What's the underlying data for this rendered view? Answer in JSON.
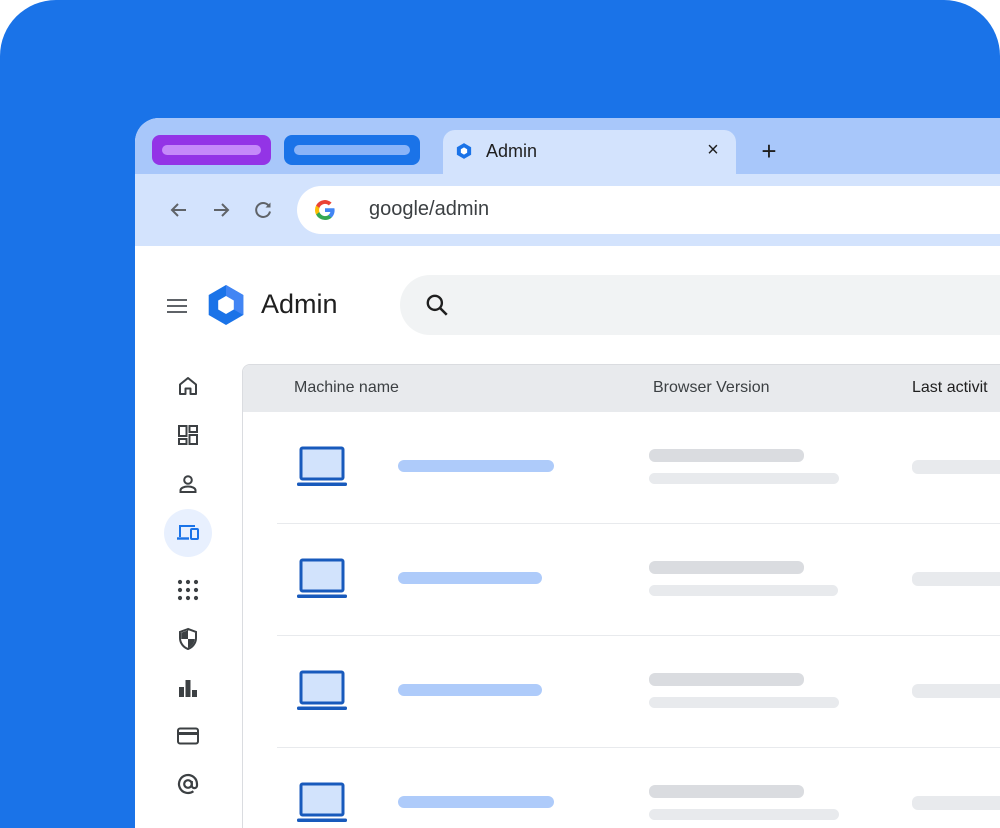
{
  "colors": {
    "backdrop": "#1a73e8",
    "tabstrip": "#a8c7fa",
    "active_tab": "#d3e3fd",
    "accent_blue": "#1a73e8",
    "purple_tab": "#9334e6",
    "skeleton_blue": "#aecbfa",
    "skeleton_gray": "#dadce0"
  },
  "browser": {
    "active_tab": {
      "title": "Admin",
      "favicon": "admin-hexagon-icon",
      "close_glyph": "×"
    },
    "new_tab_glyph": "+",
    "address_bar": {
      "url": "google/admin",
      "icon": "google-g-icon"
    }
  },
  "app": {
    "title": "Admin",
    "menu_icon": "hamburger-menu-icon",
    "search_icon": "search-icon",
    "rail": [
      {
        "name": "home-icon",
        "active": false
      },
      {
        "name": "dashboard-icon",
        "active": false
      },
      {
        "name": "person-icon",
        "active": false
      },
      {
        "name": "devices-icon",
        "active": true
      },
      {
        "name": "apps-grid-icon",
        "active": false
      },
      {
        "name": "security-shield-icon",
        "active": false
      },
      {
        "name": "reports-bar-chart-icon",
        "active": false
      },
      {
        "name": "billing-card-icon",
        "active": false
      },
      {
        "name": "at-sign-icon",
        "active": false
      }
    ]
  },
  "table": {
    "columns": [
      "Machine name",
      "Browser Version",
      "Last activit"
    ],
    "row_icon": "laptop-icon",
    "rows": 4
  }
}
